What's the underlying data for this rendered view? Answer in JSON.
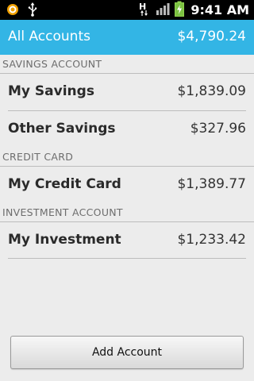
{
  "status_bar": {
    "time": "9:41 AM",
    "network_label": "H",
    "icons": [
      "notification-icon",
      "usb-icon",
      "hspa-signal-icon",
      "signal-bars-icon",
      "battery-charging-icon"
    ]
  },
  "header": {
    "title": "All Accounts",
    "total": "$4,790.24",
    "color": "#33b5e5"
  },
  "sections": [
    {
      "title": "SAVINGS ACCOUNT",
      "accounts": [
        {
          "name": "My Savings",
          "amount": "$1,839.09"
        },
        {
          "name": "Other Savings",
          "amount": "$327.96"
        }
      ]
    },
    {
      "title": "CREDIT CARD",
      "accounts": [
        {
          "name": "My Credit Card",
          "amount": "$1,389.77"
        }
      ]
    },
    {
      "title": "INVESTMENT ACCOUNT",
      "accounts": [
        {
          "name": "My Investment",
          "amount": "$1,233.42"
        }
      ]
    }
  ],
  "add_button": {
    "label": "Add Account"
  }
}
